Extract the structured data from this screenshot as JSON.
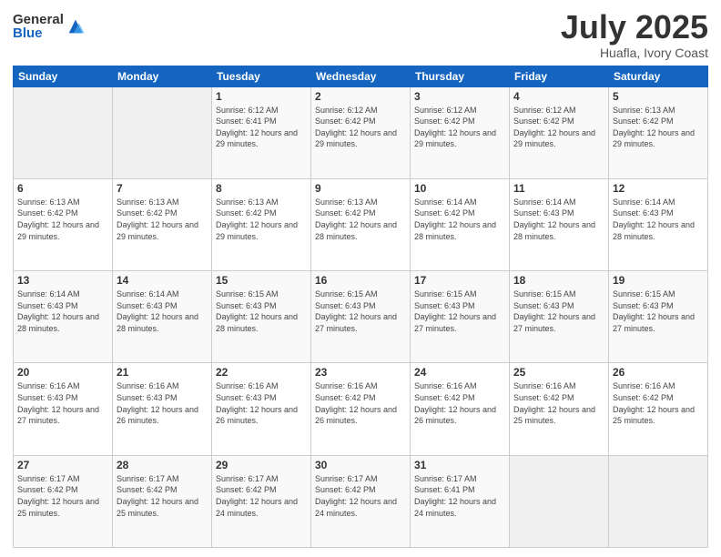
{
  "logo": {
    "general": "General",
    "blue": "Blue"
  },
  "header": {
    "month": "July 2025",
    "location": "Huafla, Ivory Coast"
  },
  "days_of_week": [
    "Sunday",
    "Monday",
    "Tuesday",
    "Wednesday",
    "Thursday",
    "Friday",
    "Saturday"
  ],
  "weeks": [
    [
      {
        "day": "",
        "info": ""
      },
      {
        "day": "",
        "info": ""
      },
      {
        "day": "1",
        "info": "Sunrise: 6:12 AM\nSunset: 6:41 PM\nDaylight: 12 hours and 29 minutes."
      },
      {
        "day": "2",
        "info": "Sunrise: 6:12 AM\nSunset: 6:42 PM\nDaylight: 12 hours and 29 minutes."
      },
      {
        "day": "3",
        "info": "Sunrise: 6:12 AM\nSunset: 6:42 PM\nDaylight: 12 hours and 29 minutes."
      },
      {
        "day": "4",
        "info": "Sunrise: 6:12 AM\nSunset: 6:42 PM\nDaylight: 12 hours and 29 minutes."
      },
      {
        "day": "5",
        "info": "Sunrise: 6:13 AM\nSunset: 6:42 PM\nDaylight: 12 hours and 29 minutes."
      }
    ],
    [
      {
        "day": "6",
        "info": "Sunrise: 6:13 AM\nSunset: 6:42 PM\nDaylight: 12 hours and 29 minutes."
      },
      {
        "day": "7",
        "info": "Sunrise: 6:13 AM\nSunset: 6:42 PM\nDaylight: 12 hours and 29 minutes."
      },
      {
        "day": "8",
        "info": "Sunrise: 6:13 AM\nSunset: 6:42 PM\nDaylight: 12 hours and 29 minutes."
      },
      {
        "day": "9",
        "info": "Sunrise: 6:13 AM\nSunset: 6:42 PM\nDaylight: 12 hours and 28 minutes."
      },
      {
        "day": "10",
        "info": "Sunrise: 6:14 AM\nSunset: 6:42 PM\nDaylight: 12 hours and 28 minutes."
      },
      {
        "day": "11",
        "info": "Sunrise: 6:14 AM\nSunset: 6:43 PM\nDaylight: 12 hours and 28 minutes."
      },
      {
        "day": "12",
        "info": "Sunrise: 6:14 AM\nSunset: 6:43 PM\nDaylight: 12 hours and 28 minutes."
      }
    ],
    [
      {
        "day": "13",
        "info": "Sunrise: 6:14 AM\nSunset: 6:43 PM\nDaylight: 12 hours and 28 minutes."
      },
      {
        "day": "14",
        "info": "Sunrise: 6:14 AM\nSunset: 6:43 PM\nDaylight: 12 hours and 28 minutes."
      },
      {
        "day": "15",
        "info": "Sunrise: 6:15 AM\nSunset: 6:43 PM\nDaylight: 12 hours and 28 minutes."
      },
      {
        "day": "16",
        "info": "Sunrise: 6:15 AM\nSunset: 6:43 PM\nDaylight: 12 hours and 27 minutes."
      },
      {
        "day": "17",
        "info": "Sunrise: 6:15 AM\nSunset: 6:43 PM\nDaylight: 12 hours and 27 minutes."
      },
      {
        "day": "18",
        "info": "Sunrise: 6:15 AM\nSunset: 6:43 PM\nDaylight: 12 hours and 27 minutes."
      },
      {
        "day": "19",
        "info": "Sunrise: 6:15 AM\nSunset: 6:43 PM\nDaylight: 12 hours and 27 minutes."
      }
    ],
    [
      {
        "day": "20",
        "info": "Sunrise: 6:16 AM\nSunset: 6:43 PM\nDaylight: 12 hours and 27 minutes."
      },
      {
        "day": "21",
        "info": "Sunrise: 6:16 AM\nSunset: 6:43 PM\nDaylight: 12 hours and 26 minutes."
      },
      {
        "day": "22",
        "info": "Sunrise: 6:16 AM\nSunset: 6:43 PM\nDaylight: 12 hours and 26 minutes."
      },
      {
        "day": "23",
        "info": "Sunrise: 6:16 AM\nSunset: 6:42 PM\nDaylight: 12 hours and 26 minutes."
      },
      {
        "day": "24",
        "info": "Sunrise: 6:16 AM\nSunset: 6:42 PM\nDaylight: 12 hours and 26 minutes."
      },
      {
        "day": "25",
        "info": "Sunrise: 6:16 AM\nSunset: 6:42 PM\nDaylight: 12 hours and 25 minutes."
      },
      {
        "day": "26",
        "info": "Sunrise: 6:16 AM\nSunset: 6:42 PM\nDaylight: 12 hours and 25 minutes."
      }
    ],
    [
      {
        "day": "27",
        "info": "Sunrise: 6:17 AM\nSunset: 6:42 PM\nDaylight: 12 hours and 25 minutes."
      },
      {
        "day": "28",
        "info": "Sunrise: 6:17 AM\nSunset: 6:42 PM\nDaylight: 12 hours and 25 minutes."
      },
      {
        "day": "29",
        "info": "Sunrise: 6:17 AM\nSunset: 6:42 PM\nDaylight: 12 hours and 24 minutes."
      },
      {
        "day": "30",
        "info": "Sunrise: 6:17 AM\nSunset: 6:42 PM\nDaylight: 12 hours and 24 minutes."
      },
      {
        "day": "31",
        "info": "Sunrise: 6:17 AM\nSunset: 6:41 PM\nDaylight: 12 hours and 24 minutes."
      },
      {
        "day": "",
        "info": ""
      },
      {
        "day": "",
        "info": ""
      }
    ]
  ]
}
